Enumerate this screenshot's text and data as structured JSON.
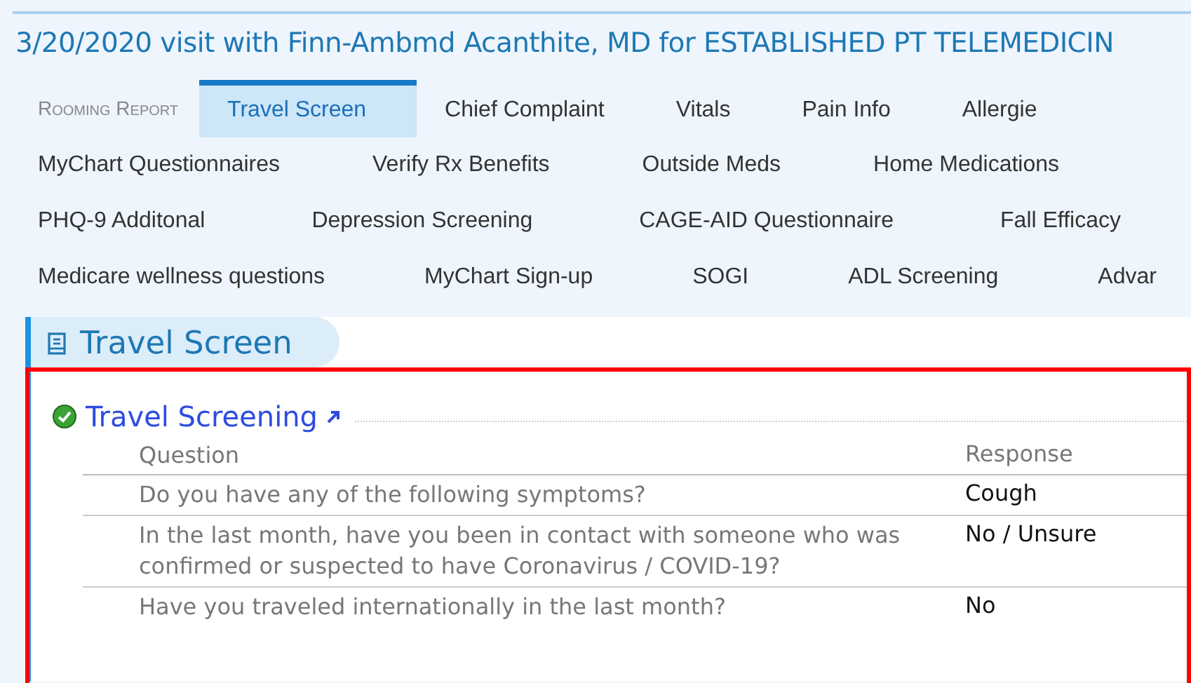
{
  "title": "3/20/2020 visit with Finn-Ambmd Acanthite, MD for ESTABLISHED PT TELEMEDICIN",
  "nav": {
    "report_label": "Rooming Report",
    "rows": [
      [
        {
          "label": "Travel Screen",
          "selected": true
        },
        {
          "label": "Chief Complaint",
          "selected": false
        },
        {
          "label": "Vitals",
          "selected": false
        },
        {
          "label": "Pain Info",
          "selected": false
        },
        {
          "label": "Allergie",
          "selected": false
        }
      ],
      [
        {
          "label": "MyChart Questionnaires",
          "selected": false
        },
        {
          "label": "Verify Rx Benefits",
          "selected": false
        },
        {
          "label": "Outside Meds",
          "selected": false
        },
        {
          "label": "Home Medications",
          "selected": false
        }
      ],
      [
        {
          "label": "PHQ-9 Additonal",
          "selected": false
        },
        {
          "label": "Depression Screening",
          "selected": false
        },
        {
          "label": "CAGE-AID Questionnaire",
          "selected": false
        },
        {
          "label": "Fall Efficacy",
          "selected": false
        }
      ],
      [
        {
          "label": "Medicare wellness questions",
          "selected": false
        },
        {
          "label": "MyChart Sign-up",
          "selected": false
        },
        {
          "label": "SOGI",
          "selected": false
        },
        {
          "label": "ADL Screening",
          "selected": false
        },
        {
          "label": "Advar",
          "selected": false
        }
      ]
    ]
  },
  "section": {
    "title": "Travel Screen"
  },
  "questionnaire": {
    "title": "Travel Screening",
    "complete": true,
    "columns": [
      "Question",
      "Response"
    ],
    "rows": [
      {
        "question": "Do you have any of the following symptoms?",
        "response": "Cough"
      },
      {
        "question": "In the last month, have you been in contact with someone who was confirmed or suspected to have Coronavirus / COVID-19?",
        "response": "No / Unsure"
      },
      {
        "question": "Have you traveled internationally in the last month?",
        "response": "No"
      }
    ]
  }
}
